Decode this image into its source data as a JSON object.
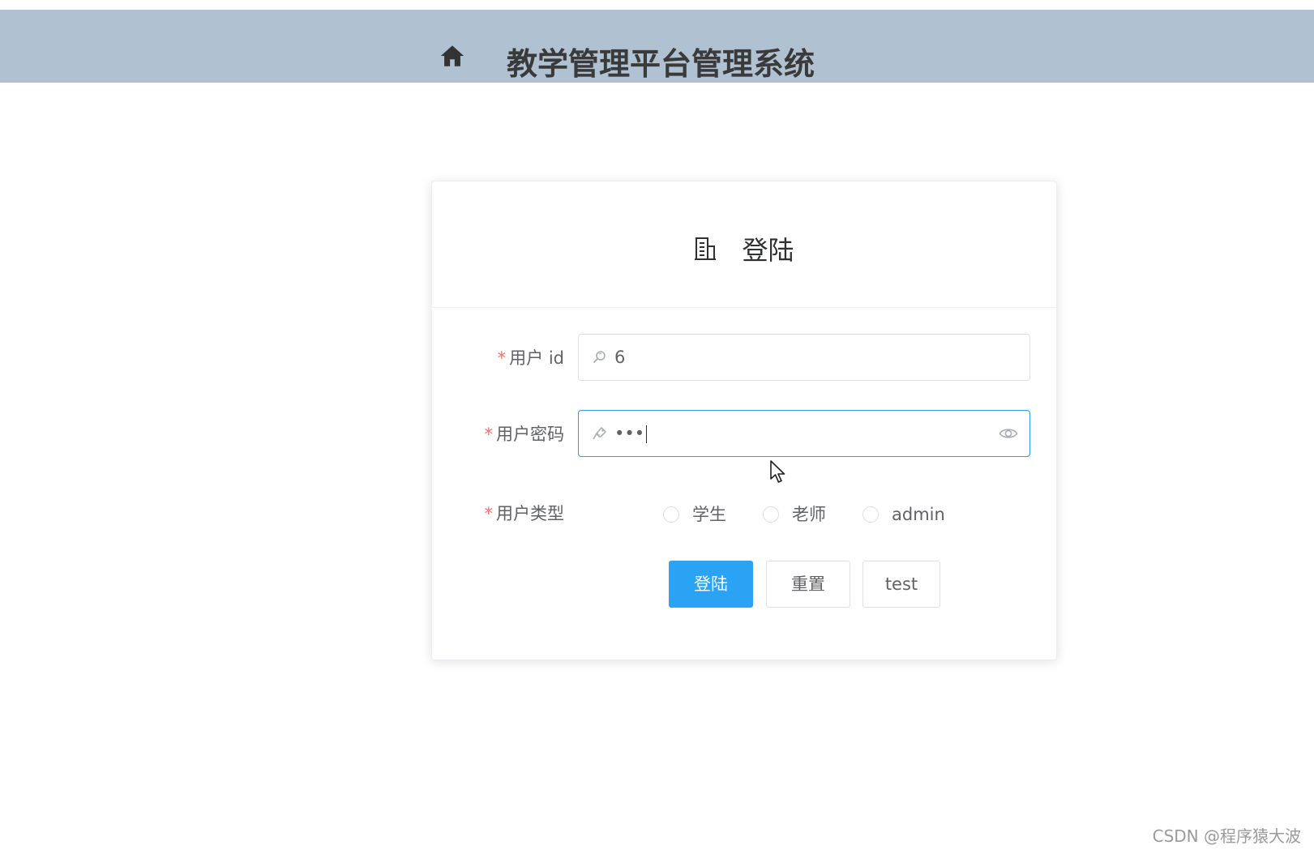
{
  "header": {
    "title": "教学管理平台管理系统",
    "background": "#b0c1d1",
    "home_icon": "home-icon"
  },
  "login_card": {
    "title": "登陆",
    "title_icon": "office-building-icon",
    "fields": {
      "user_id": {
        "label": "用户 id",
        "required": true,
        "value": "6",
        "prefix_icon": "search-icon"
      },
      "password": {
        "label": "用户密码",
        "required": true,
        "value": "•••",
        "prefix_icon": "key-icon",
        "suffix_icon": "eye-icon",
        "focused": true
      },
      "user_type": {
        "label": "用户类型",
        "required": true,
        "options": [
          "学生",
          "老师",
          "admin"
        ],
        "selected": null
      }
    },
    "buttons": {
      "login": "登陆",
      "reset": "重置",
      "test": "test"
    },
    "accent_color": "#2aa3f4",
    "required_mark": "*"
  },
  "watermark": "CSDN @程序猿大波"
}
